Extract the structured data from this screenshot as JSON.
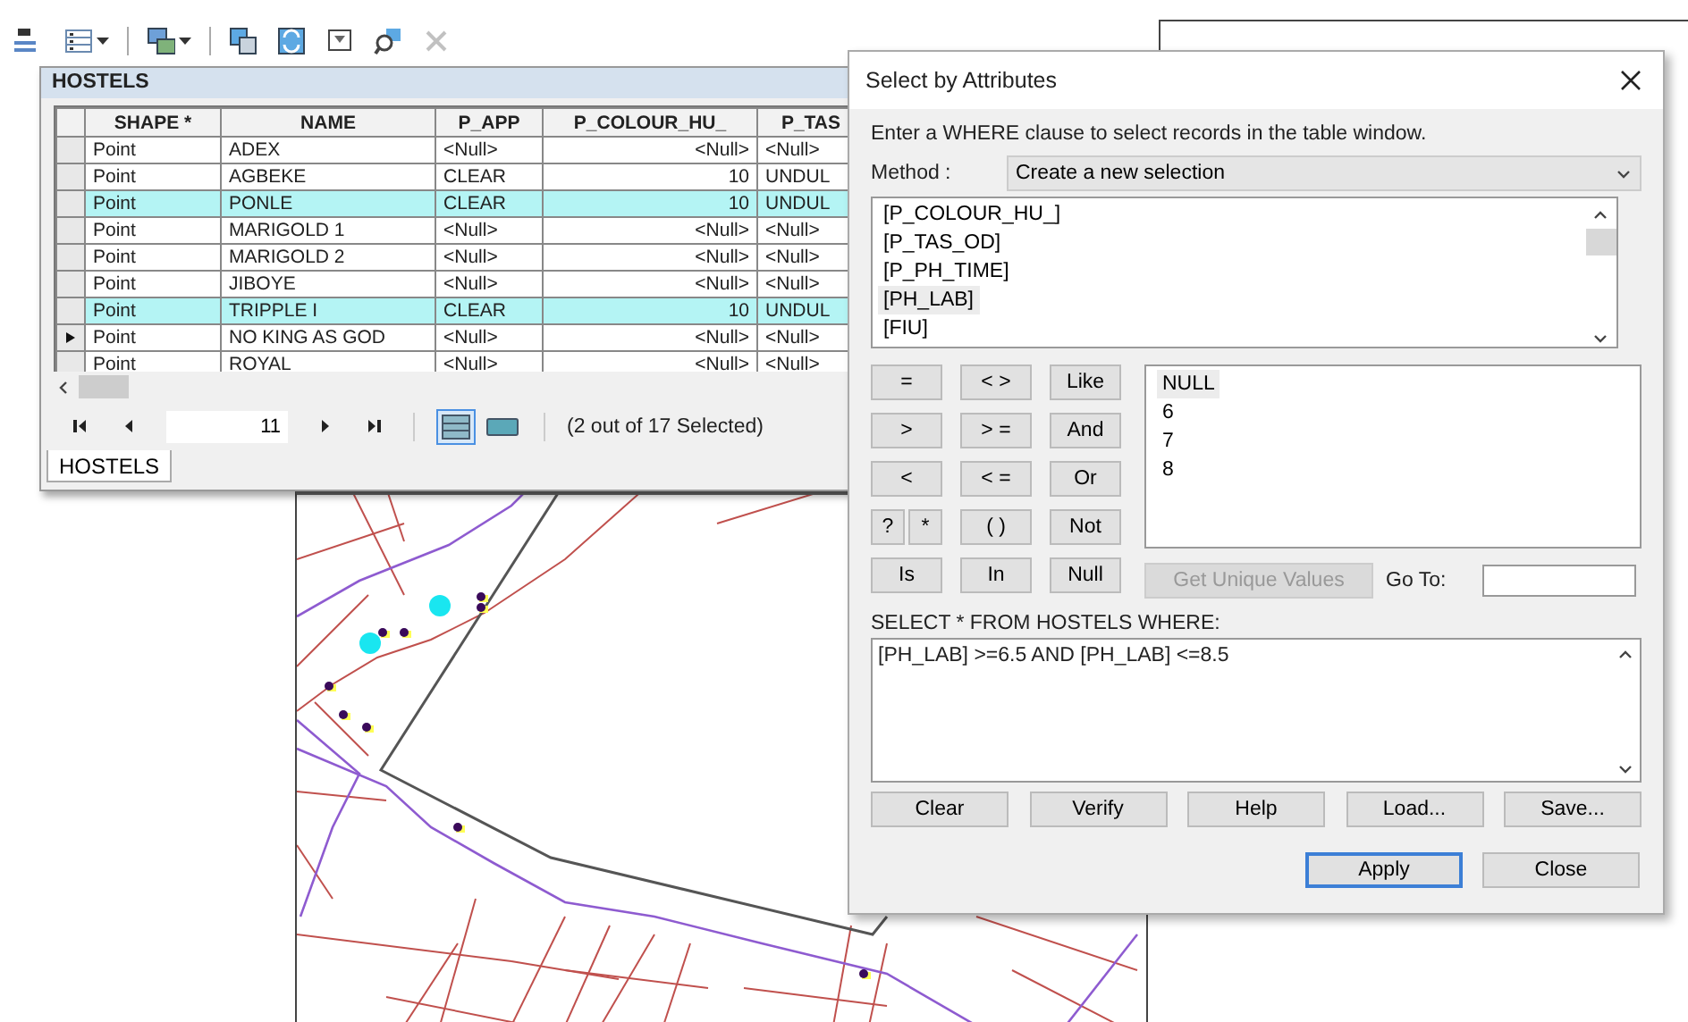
{
  "toolbar": [
    {
      "kind": "options",
      "dropdown": true,
      "disabled": false
    },
    {
      "kind": "related",
      "dropdown": true,
      "disabled": false
    },
    {
      "kind": "select",
      "dropdown": false,
      "disabled": false
    },
    {
      "kind": "switch",
      "dropdown": false,
      "disabled": false
    },
    {
      "kind": "clear",
      "dropdown": false,
      "disabled": false
    },
    {
      "kind": "zoom",
      "dropdown": false,
      "disabled": false
    },
    {
      "kind": "delete",
      "dropdown": false,
      "disabled": true
    }
  ],
  "table_window": {
    "title": "HOSTELS",
    "columns": [
      {
        "label": "SHAPE *",
        "kind": "text"
      },
      {
        "label": "NAME",
        "kind": "text"
      },
      {
        "label": "P_APP",
        "kind": "text"
      },
      {
        "label": "P_COLOUR_HU_",
        "kind": "number"
      },
      {
        "label": "P_TAS",
        "kind": "text"
      }
    ],
    "rows": [
      {
        "cells": [
          "Point",
          "ADEX",
          "<Null>",
          "<Null>",
          "<Null>"
        ],
        "selected": false,
        "current": false
      },
      {
        "cells": [
          "Point",
          "AGBEKE",
          "CLEAR",
          "10",
          "UNDUL"
        ],
        "selected": false,
        "current": false
      },
      {
        "cells": [
          "Point",
          "PONLE",
          "CLEAR",
          "10",
          "UNDUL"
        ],
        "selected": true,
        "current": false
      },
      {
        "cells": [
          "Point",
          "MARIGOLD 1",
          "<Null>",
          "<Null>",
          "<Null>"
        ],
        "selected": false,
        "current": false
      },
      {
        "cells": [
          "Point",
          "MARIGOLD 2",
          "<Null>",
          "<Null>",
          "<Null>"
        ],
        "selected": false,
        "current": false
      },
      {
        "cells": [
          "Point",
          "JIBOYE",
          "<Null>",
          "<Null>",
          "<Null>"
        ],
        "selected": false,
        "current": false
      },
      {
        "cells": [
          "Point",
          "TRIPPLE I",
          "CLEAR",
          "10",
          "UNDUL"
        ],
        "selected": true,
        "current": false
      },
      {
        "cells": [
          "Point",
          "NO KING AS GOD",
          "<Null>",
          "<Null>",
          "<Null>"
        ],
        "selected": false,
        "current": true
      },
      {
        "cells": [
          "Point",
          "ROYAL",
          "<Null>",
          "<Null>",
          "<Null>"
        ],
        "selected": false,
        "current": false
      }
    ],
    "record": "11",
    "views": [
      {
        "kind": "all",
        "selected": true
      },
      {
        "kind": "selected",
        "selected": false
      }
    ],
    "status": "(2 out of 17 Selected)",
    "tabs": [
      {
        "label": "HOSTELS",
        "selected": true
      }
    ]
  },
  "dialog": {
    "title": "Select by Attributes",
    "instruction": "Enter a WHERE clause to select records in the table window.",
    "method_label": "Method :",
    "method": "Create a new selection",
    "fields": [
      {
        "label": "[P_COLOUR_HU_]",
        "selected": false
      },
      {
        "label": "[P_TAS_OD]",
        "selected": false
      },
      {
        "label": "[P_PH_TIME]",
        "selected": false
      },
      {
        "label": "[PH_LAB]",
        "selected": true
      },
      {
        "label": "[FIU]",
        "selected": false
      }
    ],
    "operators": [
      {
        "label": "=",
        "kind": "full"
      },
      {
        "label": "< >",
        "kind": "full"
      },
      {
        "label": "Like",
        "kind": "full"
      },
      {
        "label": ">",
        "kind": "full"
      },
      {
        "label": "> =",
        "kind": "full"
      },
      {
        "label": "And",
        "kind": "full"
      },
      {
        "label": "<",
        "kind": "full"
      },
      {
        "label": "< =",
        "kind": "full"
      },
      {
        "label": "Or",
        "kind": "full"
      },
      {
        "label": "?",
        "kind": "half"
      },
      {
        "label": "*",
        "kind": "half"
      },
      {
        "label": "( )",
        "kind": "full"
      },
      {
        "label": "Not",
        "kind": "full"
      },
      {
        "label": "Is",
        "kind": "full"
      },
      {
        "label": "In",
        "kind": "full"
      },
      {
        "label": "Null",
        "kind": "full"
      }
    ],
    "values": [
      {
        "label": "NULL",
        "selected": true
      },
      {
        "label": "6",
        "selected": false
      },
      {
        "label": "7",
        "selected": false
      },
      {
        "label": "8",
        "selected": false
      }
    ],
    "unique_button": {
      "label": "Get Unique Values",
      "disabled": true
    },
    "goto_label": "Go To:",
    "query_label": "SELECT * FROM HOSTELS WHERE:",
    "expression": "[PH_LAB] >=6.5 AND [PH_LAB] <=8.5",
    "actions": [
      "Clear",
      "Verify",
      "Help",
      "Load...",
      "Save..."
    ],
    "footer": [
      {
        "label": "Apply",
        "default": true
      },
      {
        "label": "Close",
        "default": false
      }
    ]
  }
}
